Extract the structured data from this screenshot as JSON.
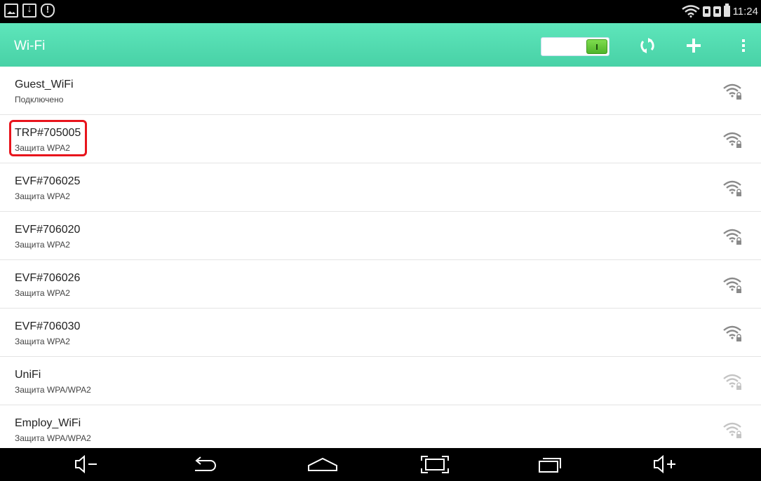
{
  "status_bar": {
    "left_icons": [
      "photo-icon",
      "download-icon",
      "shield-icon"
    ],
    "right_icons": [
      "wifi-signal-icon",
      "sim-icon",
      "sim-icon",
      "battery-icon"
    ],
    "time": "11:24"
  },
  "action_bar": {
    "title": "Wi-Fi",
    "toggle_on": true,
    "buttons": [
      "refresh-icon",
      "add-icon",
      "overflow-menu-icon"
    ]
  },
  "networks": [
    {
      "name": "Guest_WiFi",
      "status": "Подключено",
      "signal": "strong"
    },
    {
      "name": "TRP#705005",
      "status": "Защита WPA2",
      "signal": "strong",
      "highlighted": true
    },
    {
      "name": "EVF#706025",
      "status": "Защита WPA2",
      "signal": "strong"
    },
    {
      "name": "EVF#706020",
      "status": "Защита WPA2",
      "signal": "strong"
    },
    {
      "name": "EVF#706026",
      "status": "Защита WPA2",
      "signal": "strong"
    },
    {
      "name": "EVF#706030",
      "status": "Защита WPA2",
      "signal": "strong"
    },
    {
      "name": "UniFi",
      "status": "Защита WPA/WPA2",
      "signal": "weak"
    },
    {
      "name": "Employ_WiFi",
      "status": "Защита WPA/WPA2",
      "signal": "weak"
    }
  ],
  "nav_bar": {
    "buttons": [
      "volume-down-icon",
      "back-icon",
      "home-icon",
      "screenshot-icon",
      "recent-apps-icon",
      "volume-up-icon"
    ]
  },
  "colors": {
    "accent": "#4fd8ad",
    "highlight": "#e8141c",
    "toggle_on": "#5cc332"
  }
}
